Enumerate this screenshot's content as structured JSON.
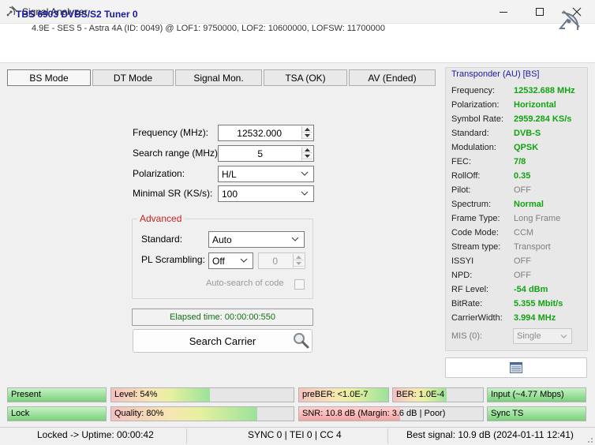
{
  "window": {
    "title": "Signal Analyzer",
    "icons": [
      "satellite-app-icon",
      "minimize-icon",
      "maximize-icon",
      "close-icon"
    ]
  },
  "header": {
    "tuner": "TBS 6903 DVBS/S2 Tuner 0",
    "satellite": "4.9E - SES 5 - Astra 4A (ID: 0049) @ LOF1: 9750000, LOF2: 10600000, LOFSW: 11700000"
  },
  "tabs": [
    {
      "label": "BS Mode",
      "active": true
    },
    {
      "label": "DT Mode"
    },
    {
      "label": "Signal Mon."
    },
    {
      "label": "TSA (OK)"
    },
    {
      "label": "AV (Ended)"
    }
  ],
  "form": {
    "frequency_label": "Frequency (MHz):",
    "frequency_value": "12532.000",
    "search_range_label": "Search range (MHz):",
    "search_range_value": "5",
    "polarization_label": "Polarization:",
    "polarization_value": "H/L",
    "minimal_sr_label": "Minimal SR (KS/s):",
    "minimal_sr_value": "100",
    "advanced_title": "Advanced",
    "standard_label": "Standard:",
    "standard_value": "Auto",
    "pl_scrambling_label": "PL Scrambling:",
    "pl_scrambling_value": "Off",
    "pl_code_value": "0",
    "autosearch_label": "Auto-search of code",
    "elapsed": "Elapsed time: 00:00:00:550",
    "search_button": "Search Carrier"
  },
  "transponder": {
    "title": "Transponder (AU) [BS]",
    "rows": [
      {
        "label": "Frequency:",
        "value": "12532.688 MHz",
        "style": "green"
      },
      {
        "label": "Polarization:",
        "value": "Horizontal",
        "style": "green"
      },
      {
        "label": "Symbol Rate:",
        "value": "2959.284 KS/s",
        "style": "green"
      },
      {
        "label": "Standard:",
        "value": "DVB-S",
        "style": "green"
      },
      {
        "label": "Modulation:",
        "value": "QPSK",
        "style": "green"
      },
      {
        "label": "FEC:",
        "value": "7/8",
        "style": "green"
      },
      {
        "label": "RollOff:",
        "value": "0.35",
        "style": "green"
      },
      {
        "label": "Pilot:",
        "value": "OFF",
        "style": "grey"
      },
      {
        "label": "Spectrum:",
        "value": "Normal",
        "style": "green"
      },
      {
        "label": "Frame Type:",
        "value": "Long Frame",
        "style": "grey"
      },
      {
        "label": "Code Mode:",
        "value": "CCM",
        "style": "grey"
      },
      {
        "label": "Stream type:",
        "value": "Transport",
        "style": "grey"
      },
      {
        "label": "ISSYI",
        "value": "OFF",
        "style": "grey"
      },
      {
        "label": "NPD:",
        "value": "OFF",
        "style": "grey"
      },
      {
        "label": "RF Level:",
        "value": "-54 dBm",
        "style": "green"
      },
      {
        "label": "BitRate:",
        "value": "5.355 Mbit/s",
        "style": "green"
      },
      {
        "label": "CarrierWidth:",
        "value": "3.994 MHz",
        "style": "green"
      }
    ],
    "mis_label": "MIS (0):",
    "mis_value": "Single"
  },
  "indicators": [
    {
      "id": "present",
      "text": "Present",
      "fill": 1.0,
      "kind": "green"
    },
    {
      "id": "level",
      "text": "Level: 54%",
      "fill": 0.54,
      "kind": "grad"
    },
    {
      "id": "preber",
      "text": "preBER: <1.0E-7",
      "fill": 1.0,
      "kind": "grad"
    },
    {
      "id": "ber",
      "text": "BER: 1.0E-4",
      "fill": 0.6,
      "kind": "grad"
    },
    {
      "id": "input",
      "text": "Input (~4.77 Mbps)",
      "fill": 1.0,
      "kind": "green"
    },
    {
      "id": "lock",
      "text": "Lock",
      "fill": 1.0,
      "kind": "green"
    },
    {
      "id": "quality",
      "text": "Quality: 80%",
      "fill": 0.8,
      "kind": "grad"
    },
    {
      "id": "snr",
      "text": "SNR: 10.8 dB (Margin: 3.6 dB | Poor)",
      "fill": 0.55,
      "kind": "red"
    },
    {
      "id": "sync",
      "text": "Sync TS",
      "fill": 1.0,
      "kind": "green"
    }
  ],
  "statusbar": {
    "uptime": "Locked -> Uptime: 00:00:42",
    "sync": "SYNC 0 | TEI 0 | CC 4",
    "best": "Best signal: 10.9 dB (2024-01-11 12:41)"
  }
}
